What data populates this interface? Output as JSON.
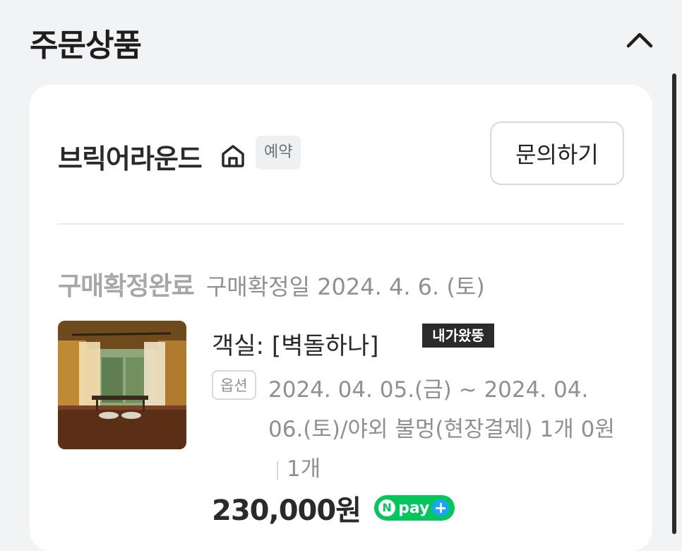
{
  "section": {
    "title": "주문상품",
    "collapse_icon": "chevron-up-icon"
  },
  "seller": {
    "name": "브릭어라운드",
    "store_icon": "home-icon",
    "badge": "예약",
    "inquiry_label": "문의하기"
  },
  "order": {
    "status": "구매확정완료",
    "confirm_date": "구매확정일 2024. 4. 6. (토)",
    "product_name": "객실: [벽돌하나]",
    "brand_tag": "내가왔뚱",
    "option_label": "옵션",
    "option_value": "2024. 04. 05.(금) ~ 2024. 04. 06.(토)/야외 불멍(현장결제) 1개 0원",
    "quantity": "1개",
    "price": "230,000원",
    "pay_badge": {
      "prefix": "N",
      "word": "pay"
    }
  },
  "colors": {
    "npay_green": "#03c75a",
    "status_gray": "#a5a7ab",
    "background": "#f2f3f5"
  }
}
